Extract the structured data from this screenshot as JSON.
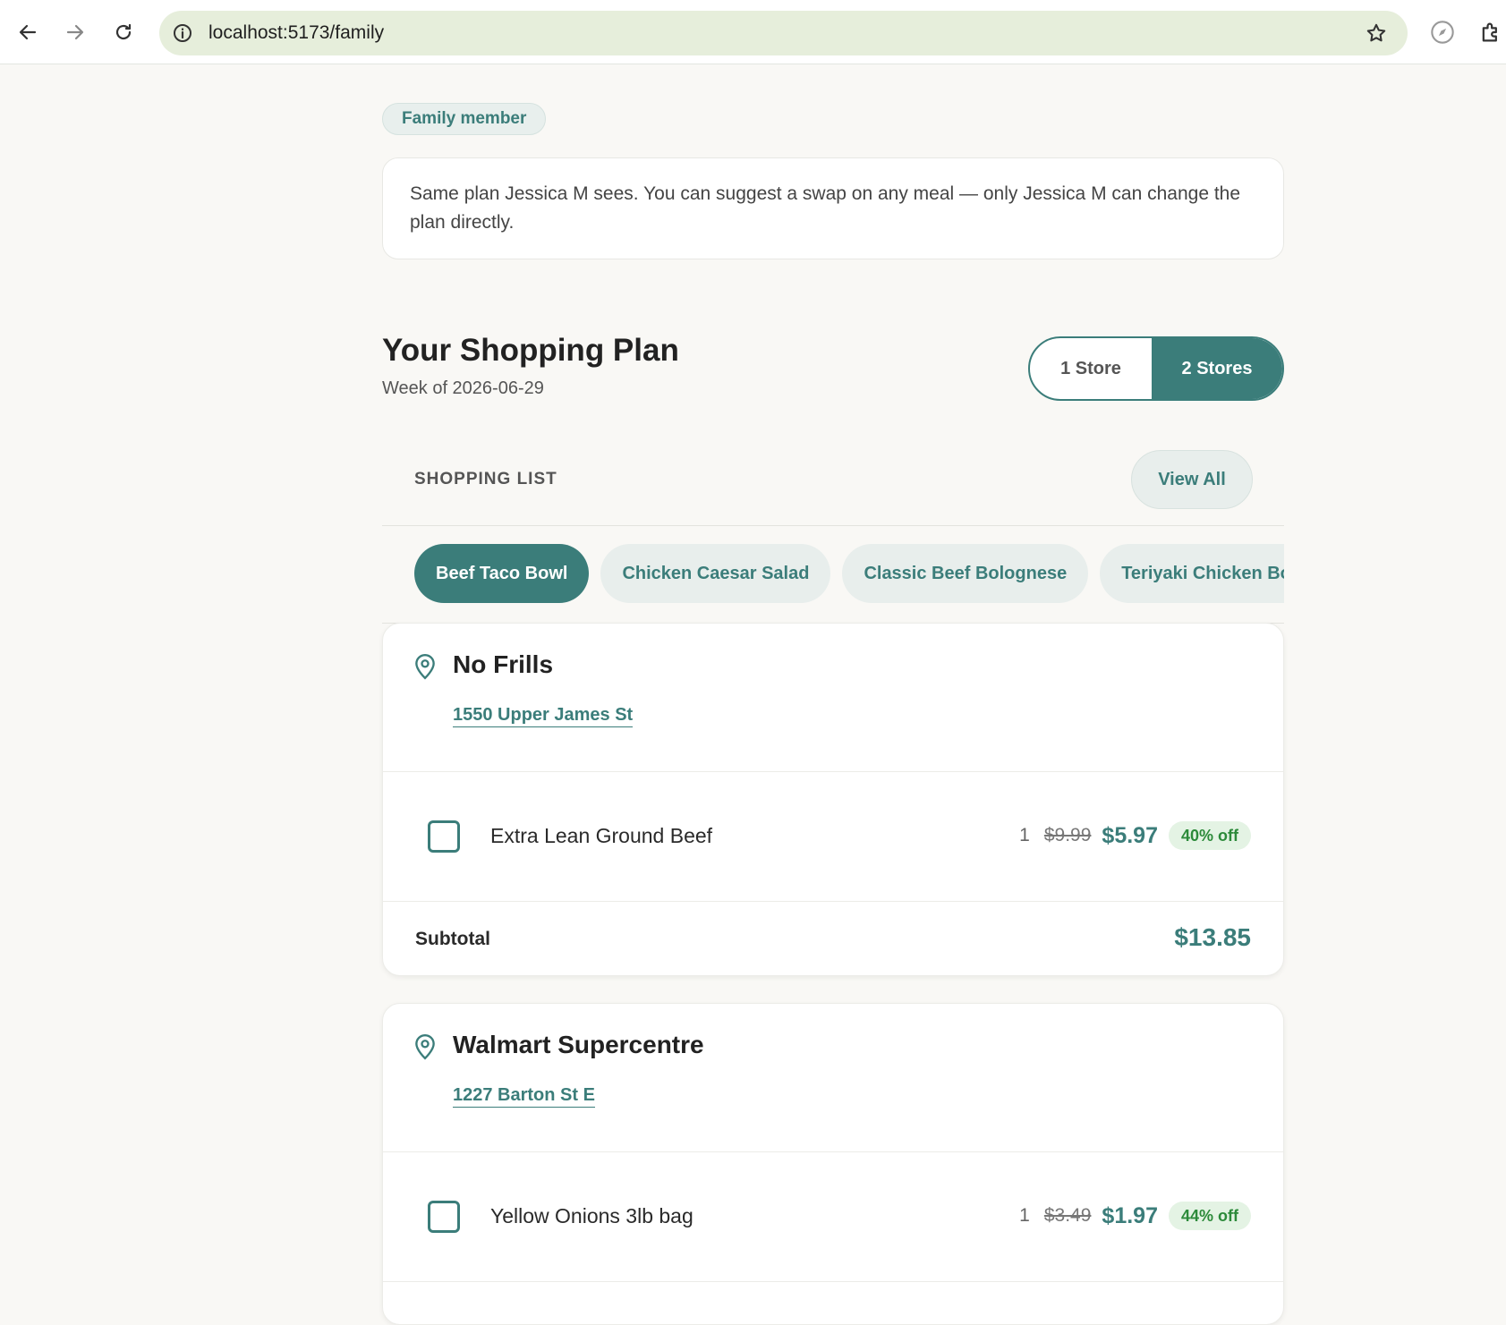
{
  "browser": {
    "url": "localhost:5173/family"
  },
  "page": {
    "role_chip": "Family member",
    "notice": "Same plan Jessica M sees. You can suggest a swap on any meal — only Jessica M can change the plan directly.",
    "title": "Your Shopping Plan",
    "week": "Week of 2026-06-29",
    "store_toggle": {
      "one_store": "1 Store",
      "two_stores": "2 Stores",
      "selected": "2 Stores"
    },
    "shopping_list_label": "SHOPPING LIST",
    "view_all": "View All",
    "meal_tabs": [
      {
        "label": "Beef Taco Bowl",
        "active": true
      },
      {
        "label": "Chicken Caesar Salad",
        "active": false
      },
      {
        "label": "Classic Beef Bolognese",
        "active": false
      },
      {
        "label": "Teriyaki Chicken Bowl",
        "active": false
      }
    ]
  },
  "stores": [
    {
      "name": "No Frills",
      "address": "1550 Upper James St",
      "items": [
        {
          "name": "Extra Lean Ground Beef",
          "qty": "1",
          "old_price": "$9.99",
          "price": "$5.97",
          "discount": "40% off"
        }
      ],
      "subtotal_label": "Subtotal",
      "subtotal": "$13.85"
    },
    {
      "name": "Walmart Supercentre",
      "address": "1227 Barton St E",
      "items": [
        {
          "name": "Yellow Onions 3lb bag",
          "qty": "1",
          "old_price": "$3.49",
          "price": "$1.97",
          "discount": "44% off"
        }
      ]
    }
  ],
  "colors": {
    "accent": "#3b7d7a",
    "discount_text": "#2c8a3a",
    "discount_bg": "#e4f3e4",
    "page_bg": "#f9f8f5"
  }
}
